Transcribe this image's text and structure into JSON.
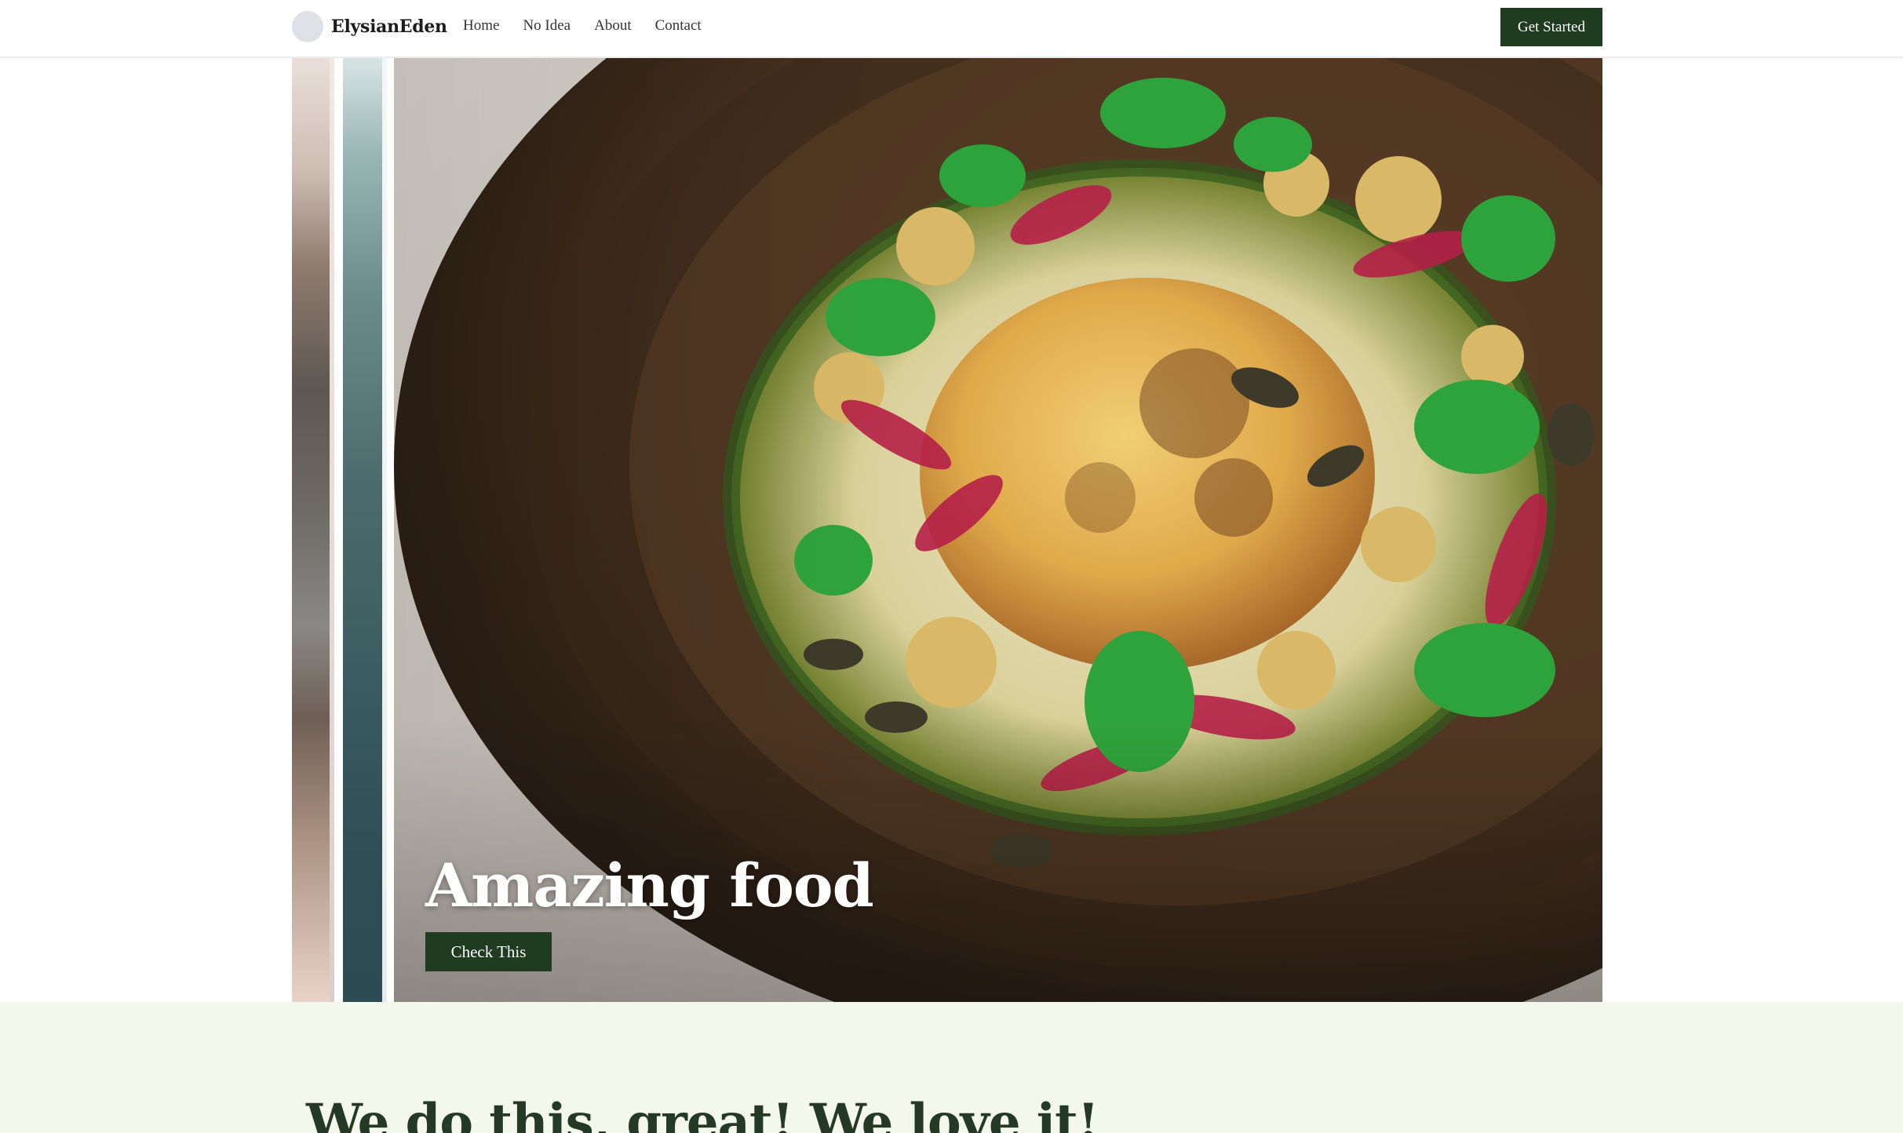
{
  "navbar": {
    "brand": "ElysianEden",
    "links": [
      {
        "label": "Home"
      },
      {
        "label": "No Idea"
      },
      {
        "label": "About"
      },
      {
        "label": "Contact"
      }
    ],
    "cta_label": "Get Started"
  },
  "hero": {
    "slide_title": "Amazing food",
    "slide_button": "Check This"
  },
  "about": {
    "heading": "We do this, great! We love it!"
  },
  "colors": {
    "accent": "#1f3b20",
    "section_bg": "#f4f8ec",
    "heading_text": "#243a25"
  }
}
